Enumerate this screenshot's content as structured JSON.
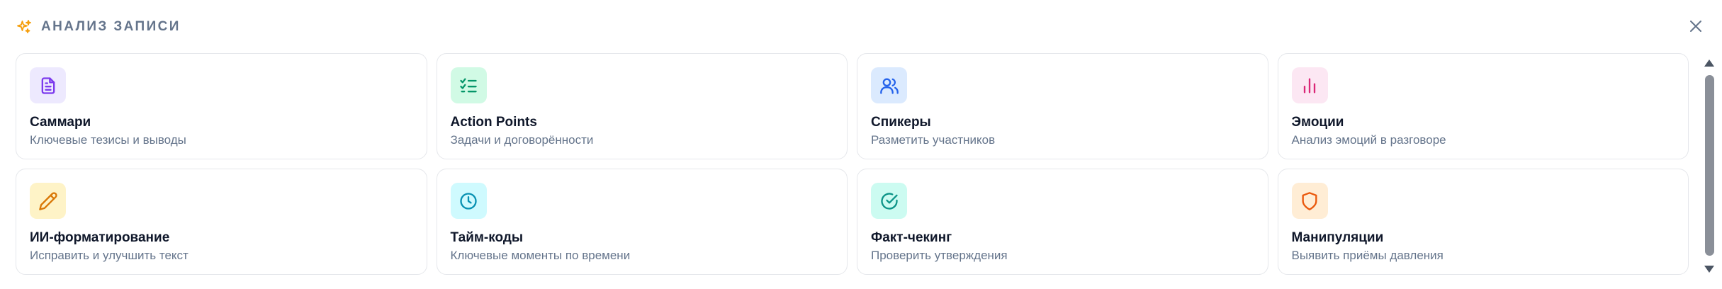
{
  "header": {
    "title": "АНАЛИЗ ЗАПИСИ",
    "icon": "sparkle-icon",
    "icon_color": "#f59e0b"
  },
  "close": {
    "icon": "close-icon"
  },
  "cards": [
    {
      "title": "Саммари",
      "subtitle": "Ключевые тезисы и выводы",
      "icon": "document-icon",
      "bg": "#ede9fe",
      "color": "#7c3aed"
    },
    {
      "title": "Action Points",
      "subtitle": "Задачи и договорённости",
      "icon": "checklist-icon",
      "bg": "#d1fae5",
      "color": "#059669"
    },
    {
      "title": "Спикеры",
      "subtitle": "Разметить участников",
      "icon": "users-icon",
      "bg": "#dbeafe",
      "color": "#2563eb"
    },
    {
      "title": "Эмоции",
      "subtitle": "Анализ эмоций в разговоре",
      "icon": "bar-chart-icon",
      "bg": "#fce7f3",
      "color": "#db2777"
    },
    {
      "title": "ИИ-форматирование",
      "subtitle": "Исправить и улучшить текст",
      "icon": "pencil-icon",
      "bg": "#fef3c7",
      "color": "#d97706"
    },
    {
      "title": "Тайм-коды",
      "subtitle": "Ключевые моменты по времени",
      "icon": "clock-icon",
      "bg": "#cffafe",
      "color": "#0891b2"
    },
    {
      "title": "Факт-чекинг",
      "subtitle": "Проверить утверждения",
      "icon": "check-circle-icon",
      "bg": "#ccfbf1",
      "color": "#0d9488"
    },
    {
      "title": "Манипуляции",
      "subtitle": "Выявить приёмы давления",
      "icon": "shield-icon",
      "bg": "#ffedd5",
      "color": "#ea580c"
    }
  ]
}
